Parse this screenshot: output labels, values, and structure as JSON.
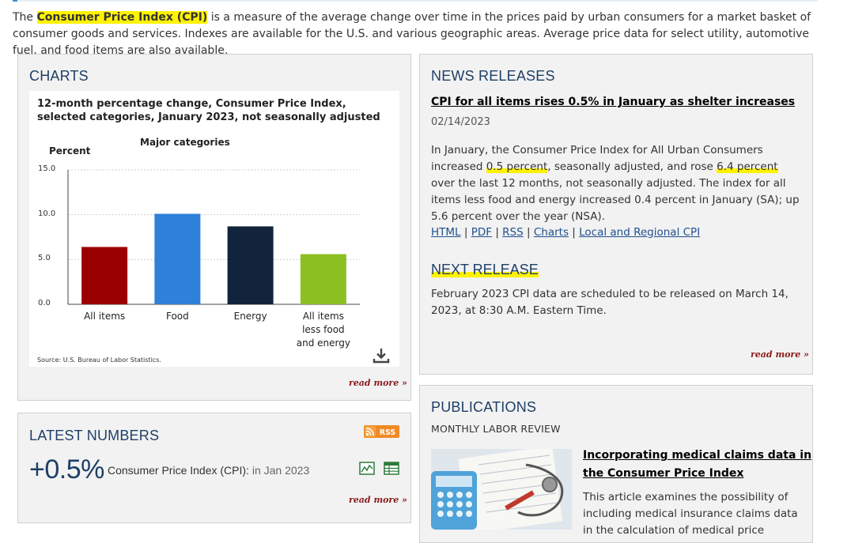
{
  "intro": {
    "prefix": "The ",
    "term": "Consumer Price Index (CPI)",
    "text": " is a measure of the average change over time in the prices paid by urban consumers for a market basket of consumer goods and services. Indexes are available for the U.S. and various geographic areas. Average price data for select utility, automotive fuel, and food items are also available."
  },
  "charts_panel": {
    "title": "CHARTS",
    "read_more": "read more »"
  },
  "chart_data": {
    "type": "bar",
    "title": "12-month percentage change, Consumer Price Index, selected categories, January 2023, not seasonally adjusted",
    "subtitle": "Major categories",
    "ylabel": "Percent",
    "ylim": [
      0,
      15
    ],
    "yticks": [
      "0.0",
      "5.0",
      "10.0",
      "15.0"
    ],
    "categories": [
      "All items",
      "Food",
      "Energy",
      "All items less food and energy"
    ],
    "category_lines": [
      [
        "All items"
      ],
      [
        "Food"
      ],
      [
        "Energy"
      ],
      [
        "All items",
        "less food",
        "and energy"
      ]
    ],
    "values": [
      6.4,
      10.1,
      8.7,
      5.6
    ],
    "colors": [
      "#9b0000",
      "#2f80d8",
      "#12243c",
      "#8cc022"
    ],
    "grid": true,
    "source": "Source: U.S. Bureau of Labor Statistics."
  },
  "latest_numbers": {
    "title": "LATEST NUMBERS",
    "rss_label": "RSS",
    "value": "+0.5%",
    "label": "Consumer Price Index (CPI):",
    "period": " in Jan 2023",
    "read_more": "read more »"
  },
  "news": {
    "title": "NEWS RELEASES",
    "headline": "CPI for all items rises 0.5% in January as shelter increases",
    "date": "02/14/2023",
    "body_1": "In January, the Consumer Price Index for All Urban Consumers increased ",
    "hl_1": "0.5 percent",
    "body_2": ", seasonally adjusted, and rose ",
    "hl_2": "6.4 percent",
    "body_3": " over the last 12 months, not seasonally adjusted. The index for all items less food and energy increased 0.4 percent in January (SA); up 5.6 percent over the year (NSA).",
    "links": [
      "HTML",
      "PDF",
      "RSS",
      "Charts",
      "Local and Regional CPI"
    ],
    "separator": " | "
  },
  "next_release": {
    "title": "NEXT RELEASE",
    "body": "February 2023 CPI data are scheduled to be released on March 14, 2023, at 8:30 A.M. Eastern Time.",
    "read_more": "read more »"
  },
  "publications": {
    "title": "PUBLICATIONS",
    "subtitle": "MONTHLY LABOR REVIEW",
    "link": "Incorporating medical claims data in the Consumer Price Index",
    "body": "This article examines the possibility of including medical insurance claims data in the calculation of medical price"
  }
}
